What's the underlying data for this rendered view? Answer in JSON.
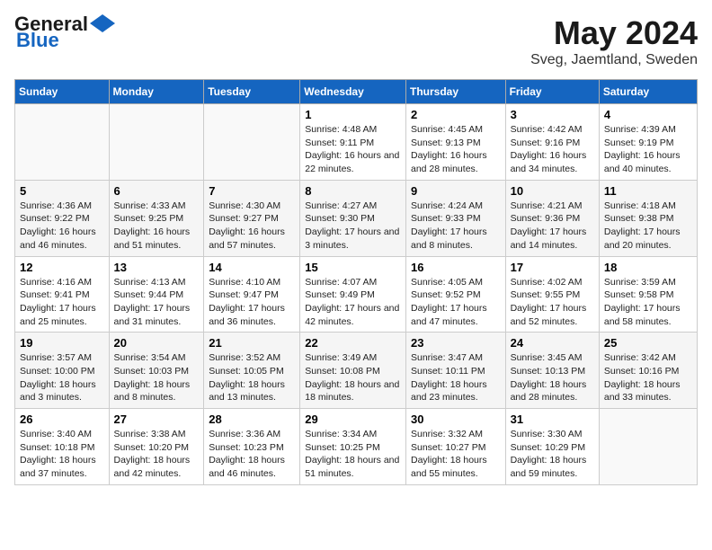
{
  "header": {
    "logo_general": "General",
    "logo_blue": "Blue",
    "title": "May 2024",
    "subtitle": "Sveg, Jaemtland, Sweden"
  },
  "columns": [
    "Sunday",
    "Monday",
    "Tuesday",
    "Wednesday",
    "Thursday",
    "Friday",
    "Saturday"
  ],
  "weeks": [
    [
      {
        "day": "",
        "info": ""
      },
      {
        "day": "",
        "info": ""
      },
      {
        "day": "",
        "info": ""
      },
      {
        "day": "1",
        "info": "Sunrise: 4:48 AM\nSunset: 9:11 PM\nDaylight: 16 hours and 22 minutes."
      },
      {
        "day": "2",
        "info": "Sunrise: 4:45 AM\nSunset: 9:13 PM\nDaylight: 16 hours and 28 minutes."
      },
      {
        "day": "3",
        "info": "Sunrise: 4:42 AM\nSunset: 9:16 PM\nDaylight: 16 hours and 34 minutes."
      },
      {
        "day": "4",
        "info": "Sunrise: 4:39 AM\nSunset: 9:19 PM\nDaylight: 16 hours and 40 minutes."
      }
    ],
    [
      {
        "day": "5",
        "info": "Sunrise: 4:36 AM\nSunset: 9:22 PM\nDaylight: 16 hours and 46 minutes."
      },
      {
        "day": "6",
        "info": "Sunrise: 4:33 AM\nSunset: 9:25 PM\nDaylight: 16 hours and 51 minutes."
      },
      {
        "day": "7",
        "info": "Sunrise: 4:30 AM\nSunset: 9:27 PM\nDaylight: 16 hours and 57 minutes."
      },
      {
        "day": "8",
        "info": "Sunrise: 4:27 AM\nSunset: 9:30 PM\nDaylight: 17 hours and 3 minutes."
      },
      {
        "day": "9",
        "info": "Sunrise: 4:24 AM\nSunset: 9:33 PM\nDaylight: 17 hours and 8 minutes."
      },
      {
        "day": "10",
        "info": "Sunrise: 4:21 AM\nSunset: 9:36 PM\nDaylight: 17 hours and 14 minutes."
      },
      {
        "day": "11",
        "info": "Sunrise: 4:18 AM\nSunset: 9:38 PM\nDaylight: 17 hours and 20 minutes."
      }
    ],
    [
      {
        "day": "12",
        "info": "Sunrise: 4:16 AM\nSunset: 9:41 PM\nDaylight: 17 hours and 25 minutes."
      },
      {
        "day": "13",
        "info": "Sunrise: 4:13 AM\nSunset: 9:44 PM\nDaylight: 17 hours and 31 minutes."
      },
      {
        "day": "14",
        "info": "Sunrise: 4:10 AM\nSunset: 9:47 PM\nDaylight: 17 hours and 36 minutes."
      },
      {
        "day": "15",
        "info": "Sunrise: 4:07 AM\nSunset: 9:49 PM\nDaylight: 17 hours and 42 minutes."
      },
      {
        "day": "16",
        "info": "Sunrise: 4:05 AM\nSunset: 9:52 PM\nDaylight: 17 hours and 47 minutes."
      },
      {
        "day": "17",
        "info": "Sunrise: 4:02 AM\nSunset: 9:55 PM\nDaylight: 17 hours and 52 minutes."
      },
      {
        "day": "18",
        "info": "Sunrise: 3:59 AM\nSunset: 9:58 PM\nDaylight: 17 hours and 58 minutes."
      }
    ],
    [
      {
        "day": "19",
        "info": "Sunrise: 3:57 AM\nSunset: 10:00 PM\nDaylight: 18 hours and 3 minutes."
      },
      {
        "day": "20",
        "info": "Sunrise: 3:54 AM\nSunset: 10:03 PM\nDaylight: 18 hours and 8 minutes."
      },
      {
        "day": "21",
        "info": "Sunrise: 3:52 AM\nSunset: 10:05 PM\nDaylight: 18 hours and 13 minutes."
      },
      {
        "day": "22",
        "info": "Sunrise: 3:49 AM\nSunset: 10:08 PM\nDaylight: 18 hours and 18 minutes."
      },
      {
        "day": "23",
        "info": "Sunrise: 3:47 AM\nSunset: 10:11 PM\nDaylight: 18 hours and 23 minutes."
      },
      {
        "day": "24",
        "info": "Sunrise: 3:45 AM\nSunset: 10:13 PM\nDaylight: 18 hours and 28 minutes."
      },
      {
        "day": "25",
        "info": "Sunrise: 3:42 AM\nSunset: 10:16 PM\nDaylight: 18 hours and 33 minutes."
      }
    ],
    [
      {
        "day": "26",
        "info": "Sunrise: 3:40 AM\nSunset: 10:18 PM\nDaylight: 18 hours and 37 minutes."
      },
      {
        "day": "27",
        "info": "Sunrise: 3:38 AM\nSunset: 10:20 PM\nDaylight: 18 hours and 42 minutes."
      },
      {
        "day": "28",
        "info": "Sunrise: 3:36 AM\nSunset: 10:23 PM\nDaylight: 18 hours and 46 minutes."
      },
      {
        "day": "29",
        "info": "Sunrise: 3:34 AM\nSunset: 10:25 PM\nDaylight: 18 hours and 51 minutes."
      },
      {
        "day": "30",
        "info": "Sunrise: 3:32 AM\nSunset: 10:27 PM\nDaylight: 18 hours and 55 minutes."
      },
      {
        "day": "31",
        "info": "Sunrise: 3:30 AM\nSunset: 10:29 PM\nDaylight: 18 hours and 59 minutes."
      },
      {
        "day": "",
        "info": ""
      }
    ]
  ]
}
